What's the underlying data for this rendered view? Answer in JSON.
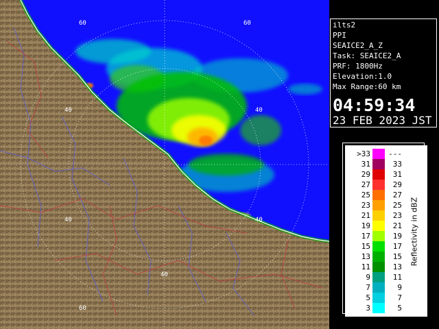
{
  "info": {
    "radar": "ilts2",
    "product": "PPI",
    "task_id": "SEAICE2_A_Z",
    "task": "Task: SEAICE2_A",
    "prf": "PRF: 1800Hz",
    "elevation": "Elevation:1.0",
    "max_range": "Max Range:60 km",
    "time": "04:59:34",
    "date": "23 FEB 2023 JST"
  },
  "map": {
    "range_labels": [
      "60",
      "40",
      "60",
      "40",
      "40",
      "40",
      "40",
      "60"
    ],
    "colors": {
      "sea": "#1010ff",
      "land": "#8a7350",
      "coast": "#ffffff",
      "rings": "#ffffff",
      "rivers": "#6060d0",
      "boundaries": "#c04040"
    }
  },
  "legend": {
    "title": "Reflectivity in dBZ",
    "rows": [
      {
        "left": ">33",
        "right": "---",
        "color": "#ff00ff"
      },
      {
        "left": "31",
        "right": "33",
        "color": "#a00060"
      },
      {
        "left": "29",
        "right": "31",
        "color": "#e00000"
      },
      {
        "left": "27",
        "right": "29",
        "color": "#ff3030"
      },
      {
        "left": "25",
        "right": "27",
        "color": "#ff7000"
      },
      {
        "left": "23",
        "right": "25",
        "color": "#ffa000"
      },
      {
        "left": "21",
        "right": "23",
        "color": "#ffd000"
      },
      {
        "left": "19",
        "right": "21",
        "color": "#ffff00"
      },
      {
        "left": "17",
        "right": "19",
        "color": "#a0ff00"
      },
      {
        "left": "15",
        "right": "17",
        "color": "#00e000"
      },
      {
        "left": "13",
        "right": "15",
        "color": "#00b000"
      },
      {
        "left": "11",
        "right": "13",
        "color": "#009000"
      },
      {
        "left": "9",
        "right": "11",
        "color": "#00a080"
      },
      {
        "left": "7",
        "right": "9",
        "color": "#00b0c0"
      },
      {
        "left": "5",
        "right": "7",
        "color": "#00d0e0"
      },
      {
        "left": "3",
        "right": "5",
        "color": "#00ffff"
      }
    ]
  }
}
